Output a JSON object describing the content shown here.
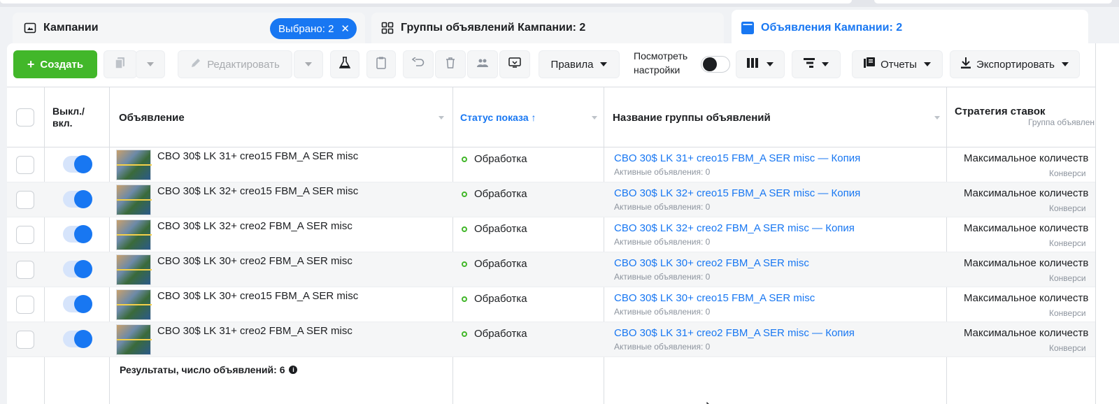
{
  "tabs": {
    "campaigns": "Кампании",
    "selected_badge": "Выбрано: 2",
    "adsets": "Группы объявлений Кампании: 2",
    "ads": "Объявления Кампании: 2"
  },
  "toolbar": {
    "create": "Создать",
    "edit": "Редактировать",
    "rules": "Правила",
    "view_settings_line1": "Посмотреть",
    "view_settings_line2": "настройки",
    "reports": "Отчеты",
    "export": "Экспортировать"
  },
  "headers": {
    "toggle_line1": "Выкл./",
    "toggle_line2": "вкл.",
    "ad": "Объявление",
    "status": "Статус показа ↑",
    "adset_name": "Название группы объявлений",
    "bid_strategy": "Стратегия ставок",
    "bid_strategy_sub": "Группа объявлен"
  },
  "rows": [
    {
      "ad": "CBO 30$ LK 31+ creo15 FBM_A SER misc",
      "status": "Обработка",
      "adset": "CBO 30$ LK 31+ creo15 FBM_A SER misc — Копия",
      "adset_sub": "Активные объявления: 0",
      "bid": "Максимальное количеств",
      "bid_sub": "Конверси"
    },
    {
      "ad": "CBO 30$ LK 32+ creo15 FBM_A SER misc",
      "status": "Обработка",
      "adset": "CBO 30$ LK 32+ creo15 FBM_A SER misc — Копия",
      "adset_sub": "Активные объявления: 0",
      "bid": "Максимальное количеств",
      "bid_sub": "Конверси"
    },
    {
      "ad": "CBO 30$ LK 32+ creo2 FBM_A SER misc",
      "status": "Обработка",
      "adset": "CBO 30$ LK 32+ creo2 FBM_A SER misc — Копия",
      "adset_sub": "Активные объявления: 0",
      "bid": "Максимальное количеств",
      "bid_sub": "Конверси"
    },
    {
      "ad": "CBO 30$ LK 30+ creo2 FBM_A SER misc",
      "status": "Обработка",
      "adset": "CBO 30$ LK 30+ creo2 FBM_A SER misc",
      "adset_sub": "Активные объявления: 0",
      "bid": "Максимальное количеств",
      "bid_sub": "Конверси"
    },
    {
      "ad": "CBO 30$ LK 30+ creo15 FBM_A SER misc",
      "status": "Обработка",
      "adset": "CBO 30$ LK 30+ creo15 FBM_A SER misc",
      "adset_sub": "Активные объявления: 0",
      "bid": "Максимальное количеств",
      "bid_sub": "Конверси"
    },
    {
      "ad": "CBO 30$ LK 31+ creo2 FBM_A SER misc",
      "status": "Обработка",
      "adset": "CBO 30$ LK 31+ creo2 FBM_A SER misc — Копия",
      "adset_sub": "Активные объявления: 0",
      "bid": "Максимальное количеств",
      "bid_sub": "Конверси"
    }
  ],
  "footer": {
    "results": "Результаты, число объявлений: 6"
  },
  "colors": {
    "accent": "#1877f2",
    "create_green": "#42b72a",
    "status_dot": "#42b72a"
  }
}
